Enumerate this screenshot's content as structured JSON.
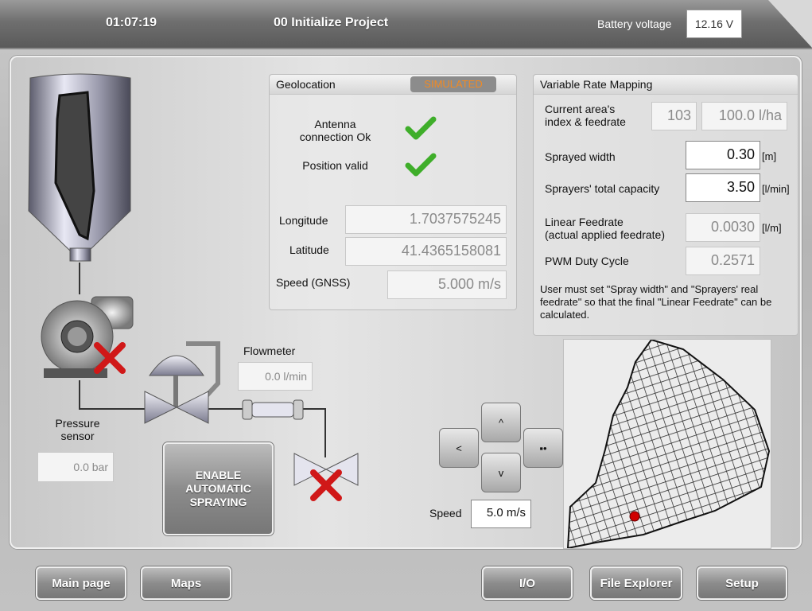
{
  "header": {
    "time": "01:07:19",
    "project": "00 Initialize Project",
    "battery_label": "Battery voltage",
    "battery_value": "12.16 V"
  },
  "geolocation": {
    "title": "Geolocation",
    "badge": "SIMULATED",
    "antenna_label": "Antenna\nconnection Ok",
    "position_label": "Position valid",
    "longitude_label": "Longitude",
    "longitude": "1.7037575245",
    "latitude_label": "Latitude",
    "latitude": "41.4365158081",
    "speed_label": "Speed (GNSS)",
    "speed": "5.000 m/s"
  },
  "vrm": {
    "title": "Variable Rate Mapping",
    "area_label": "Current area's\nindex & feedrate",
    "area_index": "103",
    "area_feedrate": "100.0 l/ha",
    "width_label": "Sprayed width",
    "width": "0.30",
    "width_unit": "[m]",
    "capacity_label": "Sprayers' total capacity",
    "capacity": "3.50",
    "capacity_unit": "[l/min]",
    "linear_label": "Linear Feedrate\n(actual applied feedrate)",
    "linear": "0.0030",
    "linear_unit": "[l/m]",
    "pwm_label": "PWM Duty Cycle",
    "pwm": "0.2571",
    "note": "User must set \"Spray width\" and \"Sprayers' real feedrate\" so that the final \"Linear Feedrate\" can be calculated."
  },
  "system": {
    "flowmeter_label": "Flowmeter",
    "flowmeter": "0.0 l/min",
    "pressure_label": "Pressure\nsensor",
    "pressure": "0.0 bar",
    "enable_button": "ENABLE\nAUTOMATIC\nSPRAYING"
  },
  "nav": {
    "up": "^",
    "down": "v",
    "left": "<",
    "right": "▪•",
    "speed_label": "Speed",
    "speed": "5.0 m/s"
  },
  "footer": {
    "main": "Main page",
    "maps": "Maps",
    "io": "I/O",
    "explorer": "File Explorer",
    "setup": "Setup"
  },
  "colors": {
    "badge_text": "#f08a24",
    "check": "#3fae2a",
    "error_x": "#d01818",
    "marker": "#d00000"
  }
}
